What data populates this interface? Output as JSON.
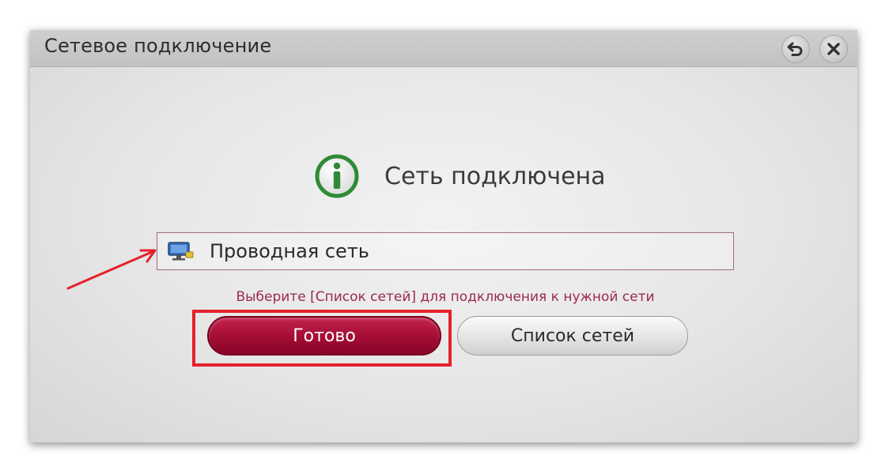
{
  "window": {
    "title": "Сетевое подключение",
    "back_icon": "back-icon",
    "close_icon": "close-icon"
  },
  "status": {
    "icon": "info-icon",
    "text": "Сеть подключена"
  },
  "connection": {
    "icon": "wired-network-icon",
    "label": "Проводная сеть"
  },
  "hint": "Выберите [Список сетей] для подключения к нужной сети",
  "buttons": {
    "done": "Готово",
    "network_list": "Список сетей"
  },
  "colors": {
    "accent": "#a30c33",
    "info_green": "#2e8b35",
    "annotation_red": "#e5212b"
  }
}
